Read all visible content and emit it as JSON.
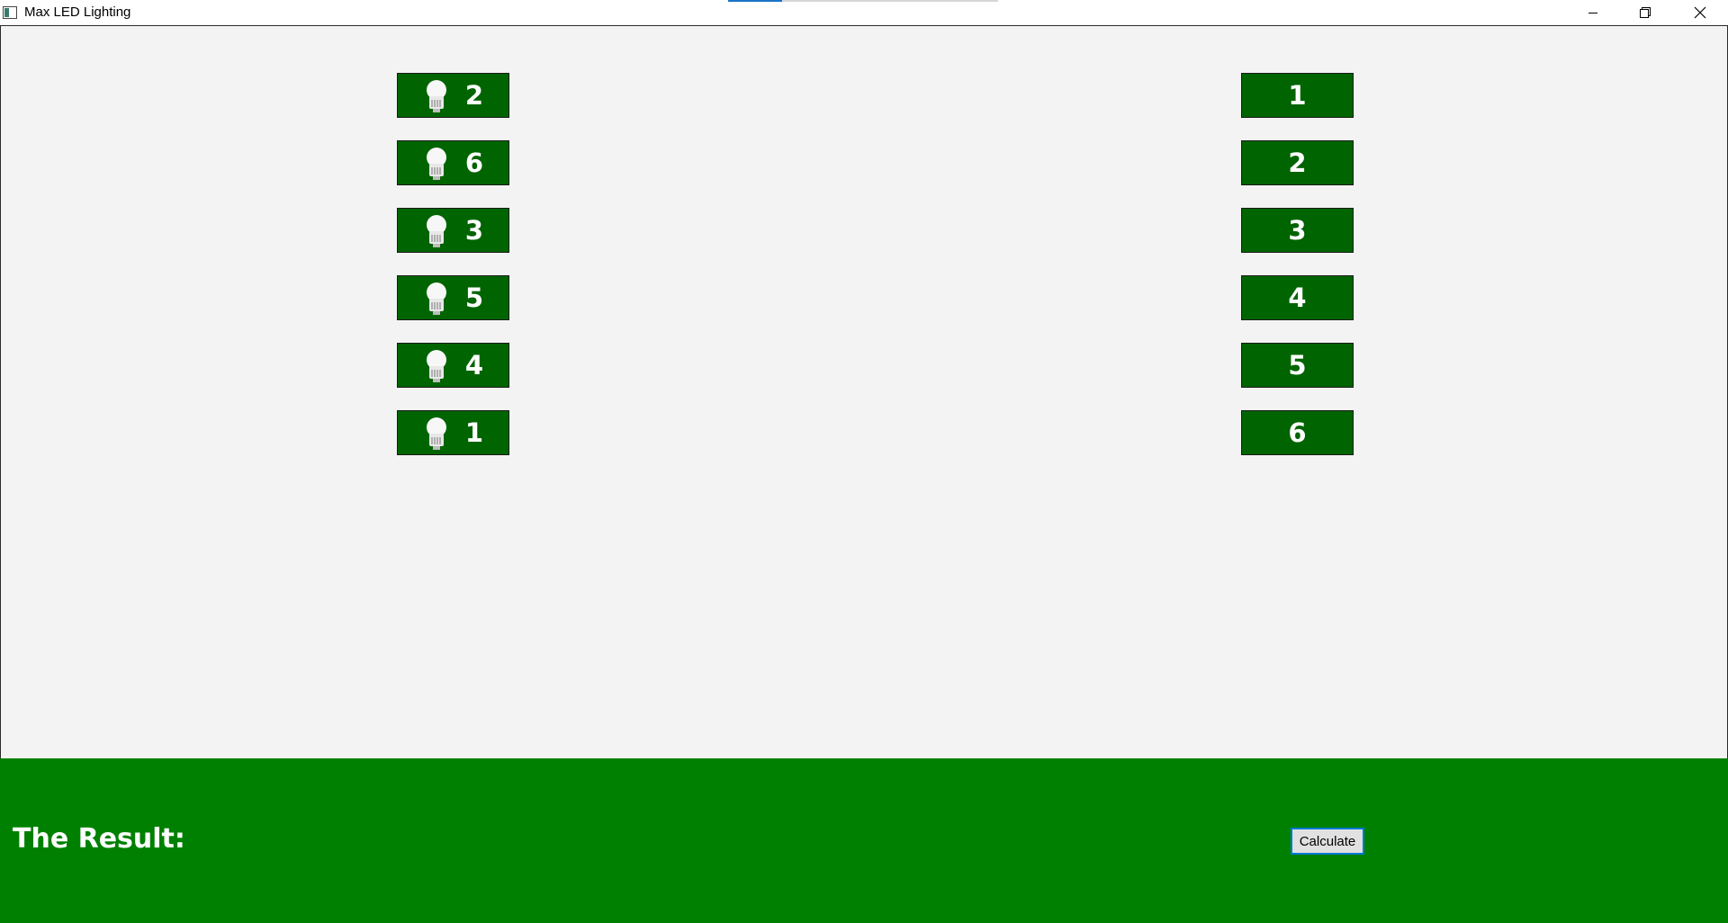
{
  "window": {
    "title": "Max LED Lighting",
    "title_progress": 0.2
  },
  "titlebar_icons": [
    "app-icon",
    "minimize-icon",
    "restore-icon",
    "close-icon"
  ],
  "leds": [
    {
      "value": "2",
      "icon": "lightbulb-icon"
    },
    {
      "value": "6",
      "icon": "lightbulb-icon"
    },
    {
      "value": "3",
      "icon": "lightbulb-icon"
    },
    {
      "value": "5",
      "icon": "lightbulb-icon"
    },
    {
      "value": "4",
      "icon": "lightbulb-icon"
    },
    {
      "value": "1",
      "icon": "lightbulb-icon"
    }
  ],
  "slots": [
    {
      "value": "1"
    },
    {
      "value": "2"
    },
    {
      "value": "3"
    },
    {
      "value": "4"
    },
    {
      "value": "5"
    },
    {
      "value": "6"
    }
  ],
  "footer": {
    "result_label": "The Result:",
    "calculate_label": "Calculate"
  },
  "colors": {
    "button_green": "#006400",
    "footer_green": "#008000",
    "background": "#f3f3f3",
    "focus_border": "#0078d7"
  }
}
